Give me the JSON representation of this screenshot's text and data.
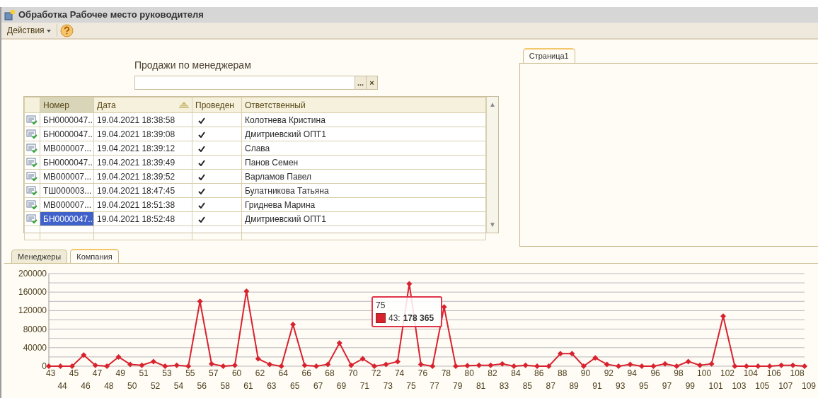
{
  "window": {
    "title": "Обработка  Рабочее место руководителя"
  },
  "toolbar": {
    "actions_menu": "Действия"
  },
  "form": {
    "title": "Продажи по менеджерам",
    "filter_buttons": [
      "...",
      "×"
    ]
  },
  "table": {
    "scroll_arrows": [
      "▲",
      "▼"
    ],
    "columns": [
      {
        "label": "Номер",
        "current": true,
        "sorted": false
      },
      {
        "label": "Дата",
        "current": false,
        "sorted": true
      },
      {
        "label": "Проведен",
        "current": false,
        "sorted": false
      },
      {
        "label": "Ответственный",
        "current": false,
        "sorted": false
      }
    ],
    "rows": [
      {
        "number": "БН0000047...",
        "date": "19.04.2021 18:38:58",
        "posted": true,
        "responsible": "Колотнева Кристина",
        "selected": false
      },
      {
        "number": "БН0000047...",
        "date": "19.04.2021 18:39:08",
        "posted": true,
        "responsible": "Дмитриевский ОПТ1",
        "selected": false
      },
      {
        "number": "МВ000007...",
        "date": "19.04.2021 18:39:12",
        "posted": true,
        "responsible": "Слава",
        "selected": false
      },
      {
        "number": "БН0000047...",
        "date": "19.04.2021 18:39:49",
        "posted": true,
        "responsible": "Панов Семен",
        "selected": false
      },
      {
        "number": "МВ000007...",
        "date": "19.04.2021 18:39:52",
        "posted": true,
        "responsible": "Варламов Павел",
        "selected": false
      },
      {
        "number": "ТШ000003...",
        "date": "19.04.2021 18:47:45",
        "posted": true,
        "responsible": "Булатникова Татьяна",
        "selected": false
      },
      {
        "number": "МВ000007...",
        "date": "19.04.2021 18:51:38",
        "posted": true,
        "responsible": "Гриднева Марина",
        "selected": false
      },
      {
        "number": "БН0000047...",
        "date": "19.04.2021 18:52:48",
        "posted": true,
        "responsible": "Дмитриевский ОПТ1",
        "selected": true
      }
    ]
  },
  "right_panel": {
    "tabs": [
      {
        "label": "Страница1",
        "selected": true
      }
    ]
  },
  "bottom_panel": {
    "tabs": [
      {
        "label": "Менеджеры",
        "selected": false
      },
      {
        "label": "Компания",
        "selected": true
      }
    ],
    "chart_data": {
      "type": "line",
      "categories": [
        "43",
        "44",
        "45",
        "46",
        "47",
        "48",
        "49",
        "50",
        "51",
        "52",
        "53",
        "54",
        "55",
        "56",
        "57",
        "58",
        "60",
        "61",
        "62",
        "63",
        "64",
        "65",
        "66",
        "67",
        "68",
        "69",
        "70",
        "71",
        "72",
        "73",
        "74",
        "75",
        "76",
        "77",
        "78",
        "79",
        "80",
        "81",
        "82",
        "83",
        "84",
        "85",
        "86",
        "87",
        "88",
        "89",
        "90",
        "91",
        "92",
        "93",
        "94",
        "95",
        "96",
        "97",
        "98",
        "99",
        "100",
        "101",
        "102",
        "103",
        "104",
        "105",
        "106",
        "107",
        "108",
        "109"
      ],
      "grid": true,
      "series": [
        {
          "color": "#d8232f",
          "marker": "diamond",
          "values": [
            0,
            0,
            0,
            24000,
            2000,
            0,
            20000,
            4000,
            2000,
            10000,
            0,
            2000,
            0,
            140000,
            5000,
            0,
            2000,
            162000,
            16000,
            4000,
            0,
            90000,
            2000,
            0,
            4000,
            50000,
            2000,
            16000,
            0,
            4000,
            10000,
            178000,
            4000,
            0,
            128000,
            0,
            1000,
            2000,
            2000,
            5000,
            0,
            2000,
            0,
            0,
            27000,
            27000,
            0,
            18000,
            4000,
            0,
            4000,
            0,
            0,
            5000,
            0,
            10000,
            2000,
            5000,
            108000,
            0,
            0,
            0,
            0,
            2000,
            2000,
            0
          ]
        }
      ],
      "ylim": [
        0,
        200000
      ],
      "yticks": [
        0,
        40000,
        80000,
        120000,
        160000,
        200000
      ]
    },
    "tooltip": {
      "title": "75",
      "series_label": "43:",
      "value": "178 365"
    }
  }
}
